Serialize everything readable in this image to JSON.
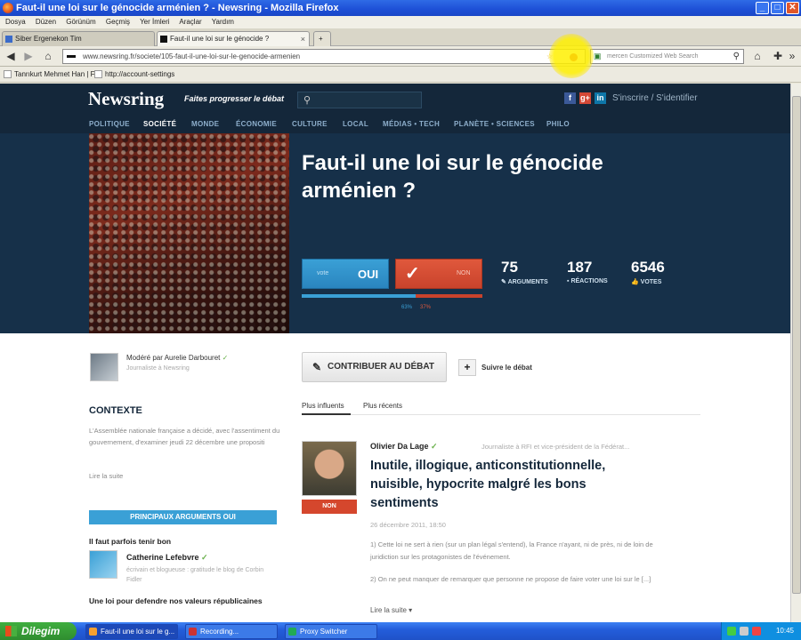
{
  "window": {
    "title": "Faut-il une loi sur le génocide arménien ? - Newsring - Mozilla Firefox",
    "min": "_",
    "max": "□",
    "close": "✕"
  },
  "menu": [
    "Dosya",
    "Düzen",
    "Görünüm",
    "Geçmiş",
    "Yer İmleri",
    "Araçlar",
    "Yardım"
  ],
  "tabs": [
    {
      "label": "Siber Ergenekon Tim",
      "active": false
    },
    {
      "label": "Faut-il une loi sur le génocide ?",
      "active": true
    }
  ],
  "new_tab": "+",
  "nav": {
    "url": "www.newsring.fr/societe/105-faut-il-une-loi-sur-le-genocide-armenien",
    "search_placeholder": "mercen Customized Web Search"
  },
  "bookmarks": [
    "Tanrıkurt Mehmet Han | F...",
    "http://account-settings"
  ],
  "site": {
    "logo": "Newsring",
    "tagline": "Faites progresser le débat",
    "auth": "S'inscrire / S'identifier",
    "social": [
      "f",
      "g+",
      "in"
    ],
    "nav": [
      "POLITIQUE",
      "SOCIÉTÉ",
      "MONDE",
      "ÉCONOMIE",
      "CULTURE",
      "LOCAL",
      "MÉDIAS • TECH",
      "PLANÈTE • SCIENCES",
      "PHILO"
    ],
    "nav_active": "SOCIÉTÉ"
  },
  "debate": {
    "title": "Faut-il une loi sur le génocide arménien ?",
    "vote_oui_small": "vote",
    "vote_oui": "OUI",
    "vote_non_small": "NON",
    "pct_oui": "63%",
    "pct_non": "37%",
    "pct_oui_value": 0.63,
    "stats": [
      {
        "n": "75",
        "label": "ARGUMENTS",
        "icon": "pen-icon"
      },
      {
        "n": "187",
        "label": "RÉACTIONS",
        "icon": "comment-icon"
      },
      {
        "n": "6546",
        "label": "VOTES",
        "icon": "thumbs-icon"
      }
    ]
  },
  "moderator": {
    "by": "Modéré par Aurelie Darbouret",
    "role": "Journaliste à Newsring"
  },
  "contexte": {
    "heading": "CONTEXTE",
    "text": "L'Assemblée nationale française a décidé, avec l'assentiment du gouvernement, d'examiner jeudi 22 décembre une propositi",
    "more": "Lire la suite"
  },
  "args": {
    "header": "PRINCIPAUX ARGUMENTS OUI",
    "q1": "Il faut parfois tenir bon",
    "author": "Catherine Lefebvre",
    "author_desc": "écrivain et blogueuse : gratitude le blog de Corbin Fidler",
    "q2": "Une loi pour defendre nos valeurs républicaines"
  },
  "actions": {
    "contribute": "CONTRIBUER AU DÉBAT",
    "follow": "Suivre le débat"
  },
  "sort": {
    "influents": "Plus influents",
    "recents": "Plus récents"
  },
  "post": {
    "tag": "NON",
    "author": "Olivier Da Lage",
    "role": "Journaliste à RFI et vice-président de la Fédérat...",
    "title": "Inutile, illogique, anticonstitutionnelle, nuisible, hypocrite malgré les bons sentiments",
    "date": "26 décembre 2011, 18:50",
    "p1": "1) Cette loi ne sert à rien (sur un plan légal s'entend), la France n'ayant, ni de près, ni de loin de juridiction sur les protagonistes de l'événement.",
    "p2": "2) On ne peut manquer de remarquer que personne ne propose de faire voter une loi sur le [...]",
    "more": "Lire la suite ▾"
  },
  "taskbar": {
    "start": "Dilegim",
    "tasks": [
      "Faut-il une loi sur le g...",
      "Recording...",
      "Proxy Switcher"
    ],
    "clock": "10:45"
  },
  "colors": {
    "header": "#14273a",
    "oui": "#3aa0d6",
    "non": "#d5472d"
  }
}
